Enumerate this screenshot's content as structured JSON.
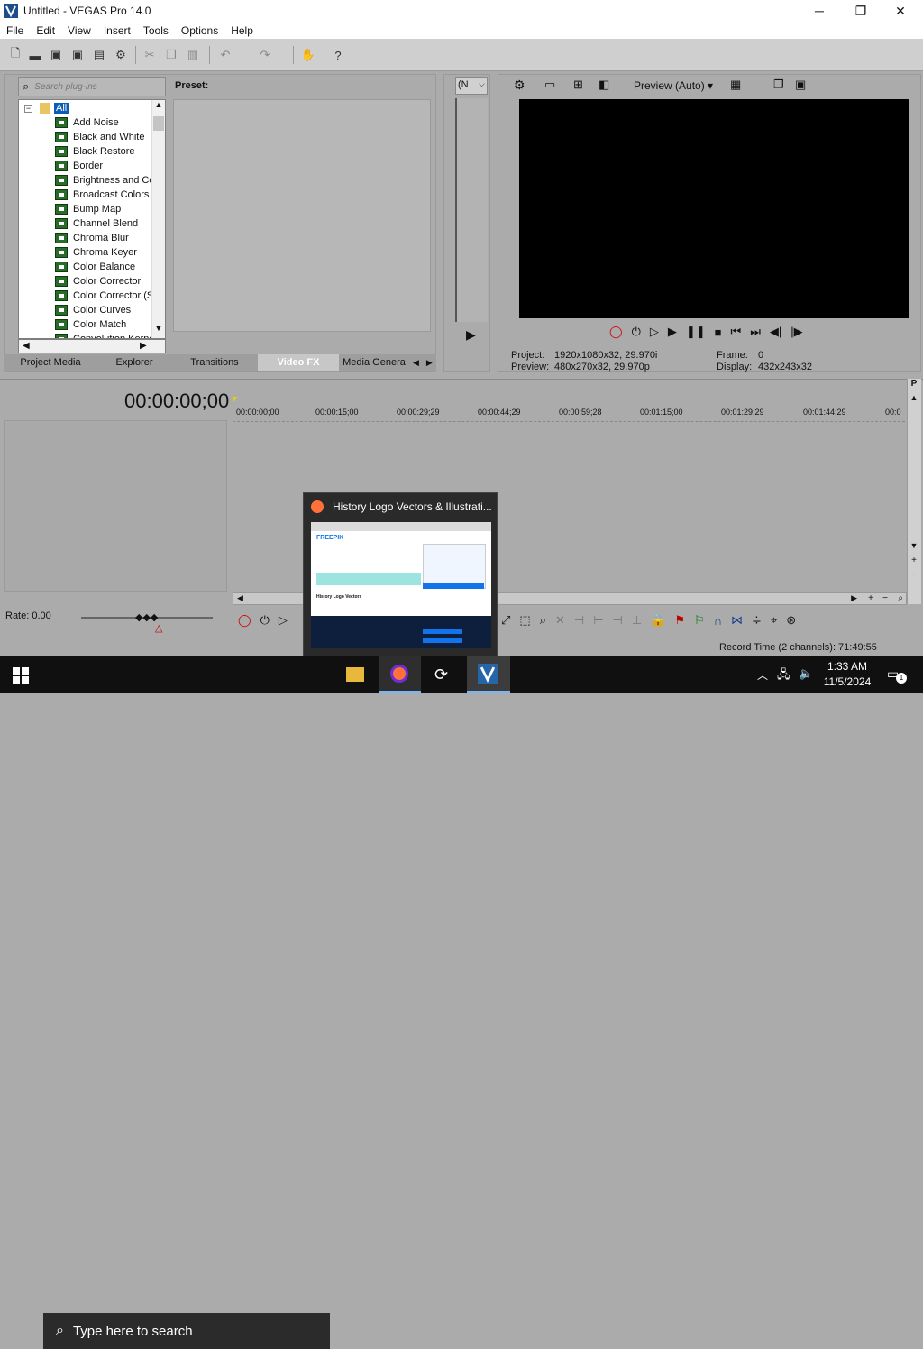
{
  "window": {
    "title": "Untitled - VEGAS Pro 14.0",
    "minimize": "─",
    "maximize": "❐",
    "close": "✕"
  },
  "menu": [
    "File",
    "Edit",
    "View",
    "Insert",
    "Tools",
    "Options",
    "Help"
  ],
  "plugin_panel": {
    "search_placeholder": "Search plug-ins",
    "preset_label": "Preset:",
    "root_label": "All",
    "items": [
      "Add Noise",
      "Black and White",
      "Black Restore",
      "Border",
      "Brightness and Co",
      "Broadcast Colors",
      "Bump Map",
      "Channel Blend",
      "Chroma Blur",
      "Chroma Keyer",
      "Color Balance",
      "Color Corrector",
      "Color Corrector (S",
      "Color Curves",
      "Color Match",
      "Convolution Kerne"
    ]
  },
  "tabs": [
    "Project Media",
    "Explorer",
    "Transitions",
    "Video FX",
    "Media Genera"
  ],
  "active_tab": "Video FX",
  "trimmer": {
    "dropdown": "(N"
  },
  "preview": {
    "quality": "Preview (Auto)",
    "project_label": "Project:",
    "project_value": "1920x1080x32, 29.970i",
    "preview_label": "Preview:",
    "preview_value": "480x270x32, 29.970p",
    "frame_label": "Frame:",
    "frame_value": "0",
    "display_label": "Display:",
    "display_value": "432x243x32"
  },
  "timeline": {
    "timecode": "00:00:00;00",
    "ruler": [
      "00:00:00;00",
      "00:00:15;00",
      "00:00:29;29",
      "00:00:44;29",
      "00:00:59;28",
      "00:01:15;00",
      "00:01:29;29",
      "00:01:44;29",
      "00:0"
    ],
    "rate": "Rate: 0.00",
    "record_time": "Record Time (2 channels): 71:49:55"
  },
  "popup": {
    "title": "History Logo Vectors & Illustrati...",
    "site": "FREEPIK",
    "heading": "History Logo Vectors"
  },
  "taskbar": {
    "search_placeholder": "Type here to search",
    "time": "1:33 AM",
    "date": "11/5/2024",
    "notification_count": "1"
  },
  "colors": {
    "accent": "#0078d7",
    "panel": "#ababab",
    "preview_bg": "#000000"
  }
}
